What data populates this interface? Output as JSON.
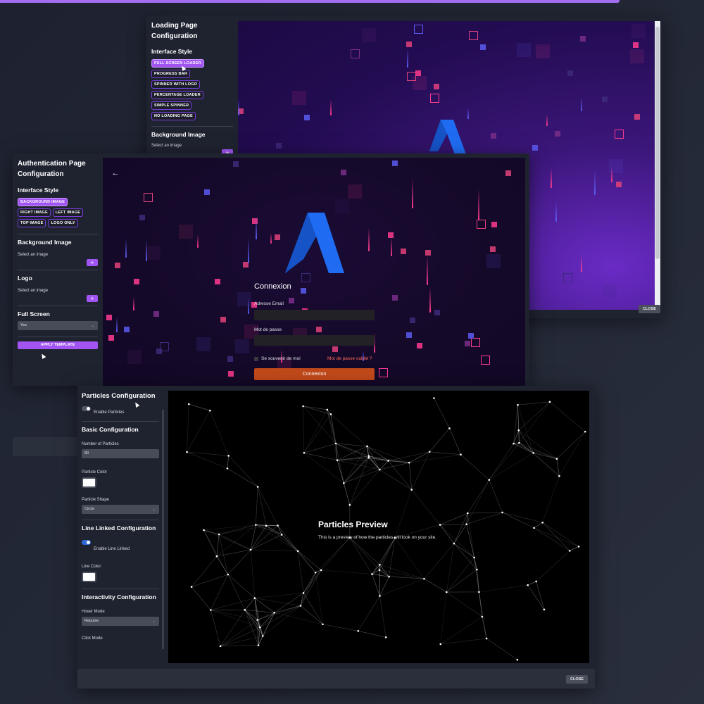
{
  "loading_window": {
    "title": "Loading Page Configuration",
    "interface_style_heading": "Interface Style",
    "styles": [
      "FULL SCREEN LOADER",
      "PROGRESS BAR",
      "SPINNER WITH LOGO",
      "PERCENTAGE LOADER",
      "SIMPLE SPINNER",
      "NO LOADING PAGE"
    ],
    "active_style": "FULL SCREEN LOADER",
    "background_heading": "Background Image",
    "select_image_label": "Select an image",
    "close_label": "CLOSE"
  },
  "auth_window": {
    "title": "Authentication Page Configuration",
    "interface_style_heading": "Interface Style",
    "styles": [
      "BACKGROUND IMAGE",
      "RIGHT IMAGE",
      "LEFT IMAGE",
      "TOP IMAGE",
      "LOGO ONLY"
    ],
    "active_style": "BACKGROUND IMAGE",
    "background_heading": "Background Image",
    "select_image_label": "Select an image",
    "logo_heading": "Logo",
    "logo_select_label": "Select an image",
    "fullscreen_heading": "Full Screen",
    "fullscreen_value": "Yes",
    "apply_label": "APPLY TEMPLATE",
    "add_label": "+",
    "form": {
      "title": "Connexion",
      "email_label": "Adresse Email",
      "password_label": "Mot de passe",
      "remember_label": "Se souvenir de moi",
      "forgot_label": "Mot de passe oublié ?",
      "submit_label": "Connexion"
    }
  },
  "particles_window": {
    "title": "Particles Configuration",
    "enable_particles_label": "Enable Particles",
    "basic_heading": "Basic Configuration",
    "number_label": "Number of Particles",
    "number_value": "80",
    "color_label": "Particle Color",
    "shape_label": "Particle Shape",
    "shape_value": "Circle",
    "line_heading": "Line Linked Configuration",
    "enable_line_label": "Enable Line Linked",
    "line_color_label": "Line Color",
    "interactivity_heading": "Interactivity Configuration",
    "hover_label": "Hover Mode",
    "hover_value": "Repulse",
    "click_label": "Click Mode",
    "preview_title": "Particles Preview",
    "preview_text": "This is a preview of how the particles will look on your site.",
    "close_label": "CLOSE"
  },
  "colors": {
    "accent_purple": "#a154f2",
    "submit_orange": "#c0491b",
    "forgot_link": "#ff6a5c",
    "logo_blue": "#1f6cf2"
  }
}
